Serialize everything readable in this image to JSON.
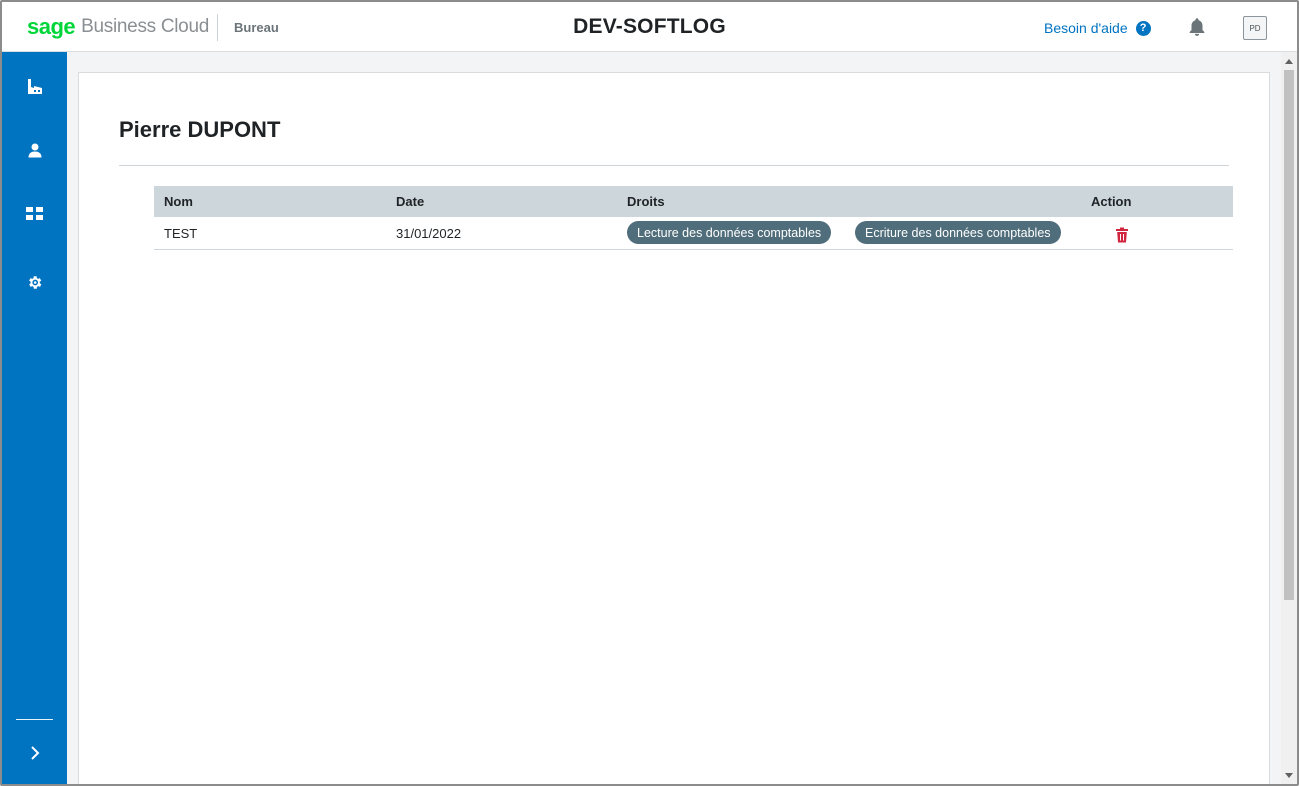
{
  "header": {
    "brand_sage": "sage",
    "brand_cloud": "Business Cloud",
    "section": "Bureau",
    "title": "DEV-SOFTLOG",
    "help_label": "Besoin d'aide",
    "help_icon": "?",
    "avatar_initials": "PD"
  },
  "sidebar": {
    "items": [
      {
        "icon": "factory-icon"
      },
      {
        "icon": "user-icon"
      },
      {
        "icon": "grid-icon"
      },
      {
        "icon": "gear-icon"
      }
    ],
    "expand_icon": "chevron-right-icon"
  },
  "main": {
    "person_name": "Pierre DUPONT",
    "table": {
      "headers": {
        "nom": "Nom",
        "date": "Date",
        "droits": "Droits",
        "action": "Action"
      },
      "rows": [
        {
          "nom": "TEST",
          "date": "31/01/2022",
          "droits": [
            "Lecture des données comptables",
            "Ecriture des données comptables"
          ]
        }
      ]
    }
  },
  "colors": {
    "sidebar": "#0073c1",
    "brand_green": "#00d639",
    "link": "#0073c1",
    "pill": "#4f6d7a",
    "delete": "#d0243f",
    "table_header": "#ccd6db"
  }
}
